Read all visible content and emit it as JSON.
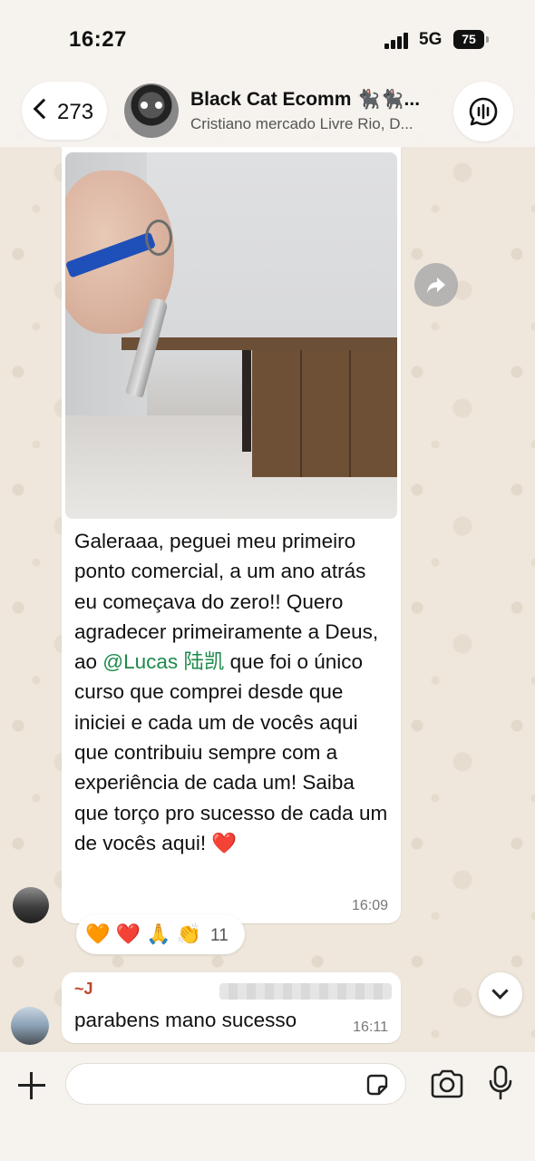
{
  "status_bar": {
    "time": "16:27",
    "network": "5G",
    "battery": "75"
  },
  "header": {
    "back_count": "273",
    "group_name": "Black Cat Ecomm 🐈‍⬛🐈‍⬛...",
    "group_subtitle": "Cristiano mercado Livre Rio, D..."
  },
  "message": {
    "text_before_mention": "Galeraaa, peguei meu primeiro ponto comercial, a um ano atrás eu começava do zero!! Quero agradecer primeiramente a Deus, ao ",
    "mention": "@Lucas 陆凯",
    "text_after_mention": " que foi o único curso que comprei desde que iniciei e cada um de vocês aqui que contribuiu sempre com a experiência de cada um! Saiba que torço pro sucesso de cada um de vocês aqui! ❤️",
    "time": "16:09",
    "reactions": "🧡 ❤️ 🙏 👏",
    "reaction_count": "11"
  },
  "message2": {
    "sender": "~J",
    "text": "parabens mano sucesso",
    "time": "16:11"
  },
  "input": {
    "placeholder": ""
  },
  "colors": {
    "mention": "#1d8a4a",
    "sender2": "#c0462a",
    "wallpaper": "#efe7dc"
  },
  "icons": [
    "back-chevron-icon",
    "group-call-icon",
    "forward-icon",
    "chevron-down-icon",
    "plus-icon",
    "sticker-icon",
    "camera-icon",
    "microphone-icon"
  ]
}
